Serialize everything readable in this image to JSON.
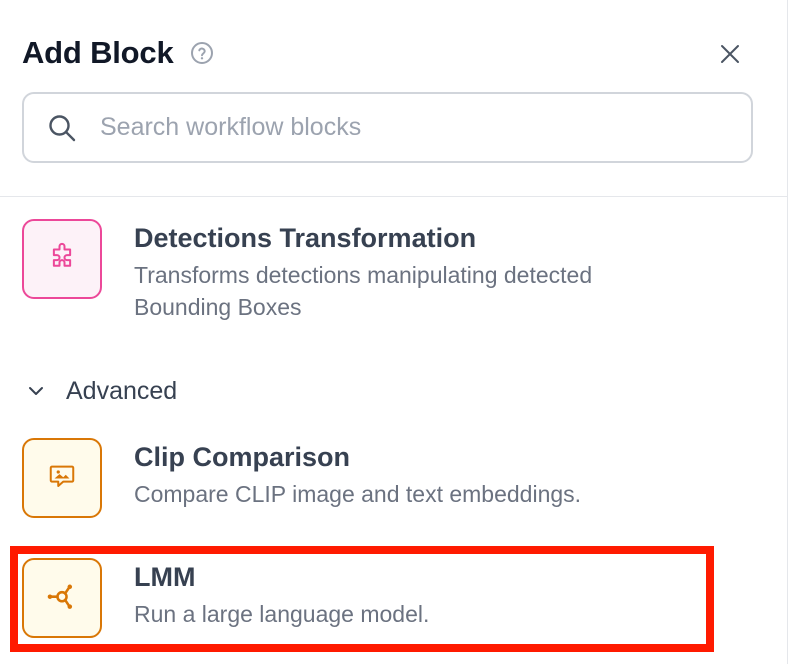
{
  "header": {
    "title": "Add Block"
  },
  "search": {
    "placeholder": "Search workflow blocks",
    "value": ""
  },
  "blocks_top": [
    {
      "title": "Detections Transformation",
      "description": "Transforms detections manipulating detected Bounding Boxes",
      "icon": "puzzle-icon",
      "color": "#ec4899"
    }
  ],
  "sections": [
    {
      "label": "Advanced",
      "expanded": true,
      "blocks": [
        {
          "title": "Clip Comparison",
          "description": "Compare CLIP image and text embeddings.",
          "icon": "image-comment-icon",
          "color": "#d97706"
        },
        {
          "title": "LMM",
          "description": "Run a large language model.",
          "icon": "network-icon",
          "color": "#d97706",
          "highlighted": true
        }
      ]
    }
  ],
  "colors": {
    "highlight": "#ff1a00",
    "pink_accent": "#ec4899",
    "orange_accent": "#d97706"
  }
}
